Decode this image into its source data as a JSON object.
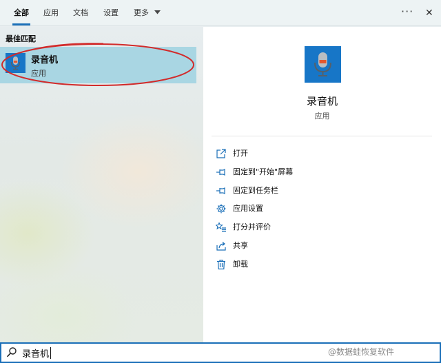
{
  "tabs": [
    {
      "label": "全部",
      "active": true
    },
    {
      "label": "应用",
      "active": false
    },
    {
      "label": "文档",
      "active": false
    },
    {
      "label": "设置",
      "active": false
    },
    {
      "label": "更多",
      "active": false
    }
  ],
  "topbar": {
    "more_options": "···",
    "close": "✕"
  },
  "best_match": {
    "section_title": "最佳匹配",
    "title": "录音机",
    "subtitle": "应用",
    "icon": "microphone-icon",
    "highlight_color": "#d22b2b"
  },
  "detail": {
    "name": "录音机",
    "type": "应用",
    "icon": "microphone-icon"
  },
  "actions": [
    {
      "label": "打开",
      "icon": "open-icon"
    },
    {
      "label": "固定到\"开始\"屏幕",
      "icon": "pin-icon"
    },
    {
      "label": "固定到任务栏",
      "icon": "pin-icon"
    },
    {
      "label": "应用设置",
      "icon": "gear-icon"
    },
    {
      "label": "打分并评价",
      "icon": "star-list-icon"
    },
    {
      "label": "共享",
      "icon": "share-icon"
    },
    {
      "label": "卸载",
      "icon": "trash-icon"
    }
  ],
  "search": {
    "value": "录音机",
    "icon": "search-icon"
  },
  "watermark": "@数据蛙恢复软件",
  "colors": {
    "accent": "#1a6fb8",
    "tile": "#1776c7",
    "selection": "#a9d6e3"
  }
}
